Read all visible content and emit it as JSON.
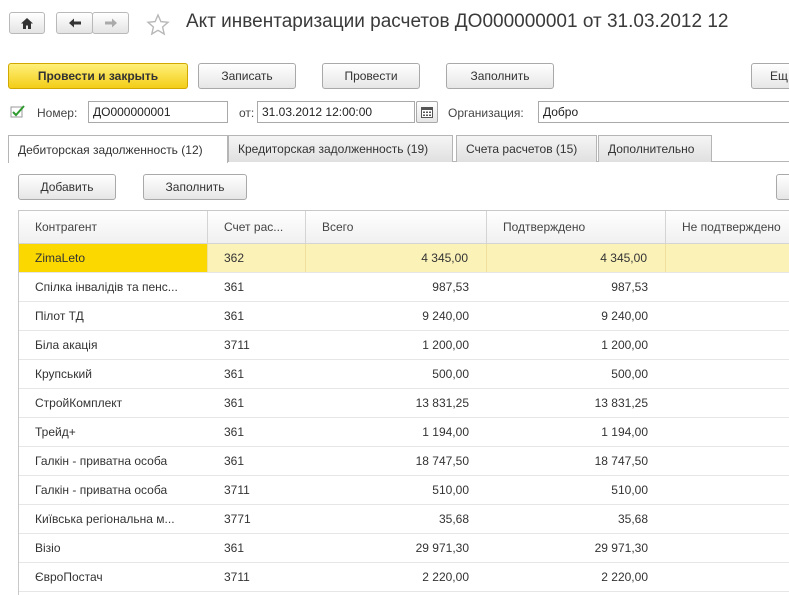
{
  "nav": {
    "home_icon": "home-icon",
    "back_icon": "arrow-left-icon",
    "forward_icon": "arrow-right-icon",
    "favorite_icon": "star-icon",
    "title": "Акт инвентаризации расчетов ДО000000001 от 31.03.2012 12"
  },
  "toolbar": {
    "post_close": "Провести и закрыть",
    "save": "Записать",
    "post": "Провести",
    "fill": "Заполнить",
    "more": "Ещ"
  },
  "form": {
    "number_label": "Номер:",
    "number_value": "ДО000000001",
    "date_label": "от:",
    "date_value": "31.03.2012 12:00:00",
    "org_label": "Организация:",
    "org_value": "Добро"
  },
  "tabs": [
    {
      "label": "Дебиторская задолженность (12)"
    },
    {
      "label": "Кредиторская задолженность (19)"
    },
    {
      "label": "Счета расчетов (15)"
    },
    {
      "label": "Дополнительно"
    }
  ],
  "table_toolbar": {
    "add": "Добавить",
    "fill": "Заполнить"
  },
  "table": {
    "columns": [
      "Контрагент",
      "Счет рас...",
      "Всего",
      "Подтверждено",
      "Не подтверждено"
    ],
    "rows": [
      {
        "name": "ZimaLeto",
        "account": "362",
        "total": "4 345,00",
        "confirmed": "4 345,00"
      },
      {
        "name": "Спілка інвалідів та пенс...",
        "account": "361",
        "total": "987,53",
        "confirmed": "987,53"
      },
      {
        "name": "Пілот ТД",
        "account": "361",
        "total": "9 240,00",
        "confirmed": "9 240,00"
      },
      {
        "name": "Біла акація",
        "account": "3711",
        "total": "1 200,00",
        "confirmed": "1 200,00"
      },
      {
        "name": "Крупський",
        "account": "361",
        "total": "500,00",
        "confirmed": "500,00"
      },
      {
        "name": "СтройКомплект",
        "account": "361",
        "total": "13 831,25",
        "confirmed": "13 831,25"
      },
      {
        "name": "Трейд+",
        "account": "361",
        "total": "1 194,00",
        "confirmed": "1 194,00"
      },
      {
        "name": "Галкін - приватна особа",
        "account": "361",
        "total": "18 747,50",
        "confirmed": "18 747,50"
      },
      {
        "name": "Галкін - приватна особа",
        "account": "3711",
        "total": "510,00",
        "confirmed": "510,00"
      },
      {
        "name": "Київська регіональна м...",
        "account": "3771",
        "total": "35,68",
        "confirmed": "35,68"
      },
      {
        "name": "Візіо",
        "account": "361",
        "total": "29 971,30",
        "confirmed": "29 971,30"
      },
      {
        "name": "ЄвроПостач",
        "account": "3711",
        "total": "2 220,00",
        "confirmed": "2 220,00"
      }
    ]
  },
  "colors": {
    "primary_button": "#f3cd18",
    "selected_row": "#fbf2b8",
    "selected_cell": "#fbd900"
  }
}
